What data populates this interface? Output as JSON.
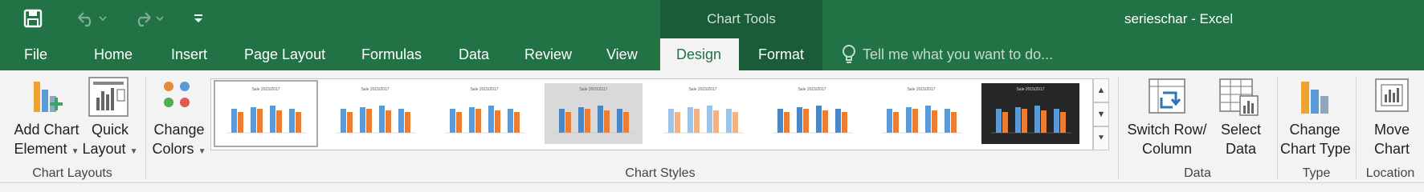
{
  "qat": {
    "save_icon": "save-icon",
    "undo_icon": "undo-icon",
    "redo_icon": "redo-icon",
    "customize_icon": "customize-qat-icon"
  },
  "title_bar": {
    "contextual_label": "Chart Tools",
    "document_title": "serieschar - Excel"
  },
  "tabs": {
    "file": "File",
    "home": "Home",
    "insert": "Insert",
    "page_layout": "Page Layout",
    "formulas": "Formulas",
    "data": "Data",
    "review": "Review",
    "view": "View",
    "design": "Design",
    "format": "Format",
    "active": "Design"
  },
  "tell_me": {
    "icon": "lightbulb-icon",
    "text": "Tell me what you want to do..."
  },
  "ribbon": {
    "chart_layouts": {
      "label": "Chart Layouts",
      "add_chart_element": {
        "line1": "Add Chart",
        "line2": "Element"
      },
      "quick_layout": {
        "line1": "Quick",
        "line2": "Layout"
      }
    },
    "change_colors": {
      "line1": "Change",
      "line2": "Colors"
    },
    "chart_styles": {
      "label": "Chart Styles",
      "thumb_title": "Sale 2015/2017",
      "styles": [
        {
          "name": "Style 1",
          "selected": true,
          "background": "#ffffff",
          "bar_a": "#5b9bd5",
          "bar_b": "#ed7d31"
        },
        {
          "name": "Style 2",
          "selected": false,
          "background": "#ffffff",
          "bar_a": "#5b9bd5",
          "bar_b": "#ed7d31"
        },
        {
          "name": "Style 3",
          "selected": false,
          "background": "#ffffff",
          "bar_a": "#5b9bd5",
          "bar_b": "#ed7d31"
        },
        {
          "name": "Style 4",
          "selected": false,
          "background": "#d9d9d9",
          "bar_a": "#4a86c5",
          "bar_b": "#ed7d31"
        },
        {
          "name": "Style 5",
          "selected": false,
          "background": "#ffffff",
          "bar_a": "#9dc3e6",
          "bar_b": "#f4b183"
        },
        {
          "name": "Style 6",
          "selected": false,
          "background": "#ffffff",
          "bar_a": "#4a86c5",
          "bar_b": "#ed7d31"
        },
        {
          "name": "Style 7",
          "selected": false,
          "background": "#ffffff",
          "bar_a": "#5b9bd5",
          "bar_b": "#ed7d31"
        },
        {
          "name": "Style 8",
          "selected": false,
          "background": "#262626",
          "bar_a": "#5b9bd5",
          "bar_b": "#ed7d31"
        }
      ]
    },
    "data_group": {
      "label": "Data",
      "switch_row_column": {
        "line1": "Switch Row/",
        "line2": "Column"
      },
      "select_data": {
        "line1": "Select",
        "line2": "Data"
      }
    },
    "type_group": {
      "label": "Type",
      "change_chart_type": {
        "line1": "Change",
        "line2": "Chart Type"
      }
    },
    "location_group": {
      "label": "Location",
      "move_chart": {
        "line1": "Move",
        "line2": "Chart"
      }
    }
  },
  "colors": {
    "excel_green": "#217346",
    "contextual_green": "#1a5c38",
    "ribbon_bg": "#f3f3f3",
    "series_blue": "#5b9bd5",
    "series_orange": "#ed7d31"
  }
}
